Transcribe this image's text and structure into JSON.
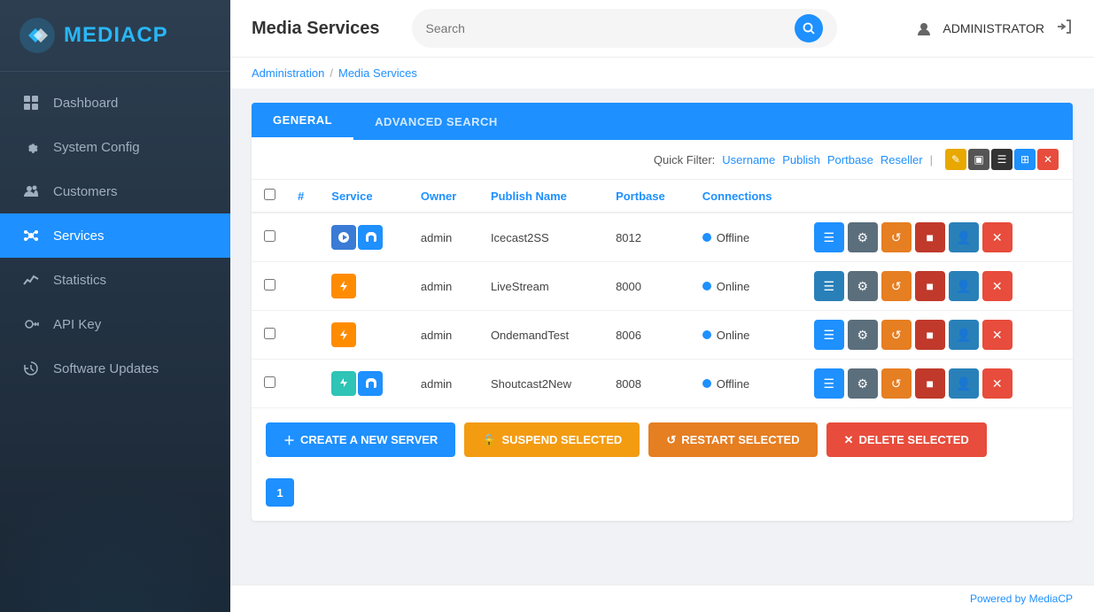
{
  "sidebar": {
    "logo_text_media": "MEDIA",
    "logo_text_cp": "CP",
    "nav_items": [
      {
        "id": "dashboard",
        "label": "Dashboard",
        "icon": "⊞",
        "active": false
      },
      {
        "id": "system-config",
        "label": "System Config",
        "icon": "⚙",
        "active": false
      },
      {
        "id": "customers",
        "label": "Customers",
        "icon": "👥",
        "active": false
      },
      {
        "id": "services",
        "label": "Services",
        "icon": "⬡",
        "active": true
      },
      {
        "id": "statistics",
        "label": "Statistics",
        "icon": "📈",
        "active": false
      },
      {
        "id": "api-key",
        "label": "API Key",
        "icon": "🌐",
        "active": false
      },
      {
        "id": "software-updates",
        "label": "Software Updates",
        "icon": "☁",
        "active": false
      }
    ]
  },
  "topbar": {
    "page_title": "Media Services",
    "search_placeholder": "Search",
    "admin_label": "ADMINISTRATOR",
    "logout_icon": "→"
  },
  "breadcrumb": {
    "admin_link": "Administration",
    "separator": "/",
    "current": "Media Services"
  },
  "tabs": [
    {
      "id": "general",
      "label": "GENERAL",
      "active": true
    },
    {
      "id": "advanced-search",
      "label": "ADVANCED SEARCH",
      "active": false
    }
  ],
  "quick_filter": {
    "label": "Quick Filter:",
    "filters": [
      "Username",
      "Publish",
      "Portbase",
      "Reseller"
    ],
    "separator": "|"
  },
  "table": {
    "columns": [
      "#",
      "Service",
      "Owner",
      "Publish Name",
      "Portbase",
      "Connections",
      ""
    ],
    "rows": [
      {
        "id": 1,
        "icons": [
          "icecast-blue",
          "headphone-white"
        ],
        "owner": "admin",
        "publish_name": "Icecast2SS",
        "portbase": "8012",
        "connections": "-",
        "status": "Offline",
        "status_type": "offline"
      },
      {
        "id": 2,
        "icons": [
          "bolt-orange"
        ],
        "owner": "admin",
        "publish_name": "LiveStream",
        "portbase": "8000",
        "connections": "-",
        "status": "Online",
        "status_type": "online"
      },
      {
        "id": 3,
        "icons": [
          "bolt-orange"
        ],
        "owner": "admin",
        "publish_name": "OndemandTest",
        "portbase": "8006",
        "connections": "-",
        "status": "Online",
        "status_type": "online"
      },
      {
        "id": 4,
        "icons": [
          "zap-teal",
          "headphone-white"
        ],
        "owner": "admin",
        "publish_name": "Shoutcast2New",
        "portbase": "8008",
        "connections": "-",
        "status": "Offline",
        "status_type": "offline"
      }
    ]
  },
  "actions": {
    "create": "CREATE A NEW SERVER",
    "suspend": "SUSPEND SELECTED",
    "restart": "RESTART SELECTED",
    "delete": "DELETE SELECTED"
  },
  "pagination": {
    "current_page": 1,
    "pages": [
      1
    ]
  },
  "footer": {
    "text": "Powered by MediaCP"
  }
}
